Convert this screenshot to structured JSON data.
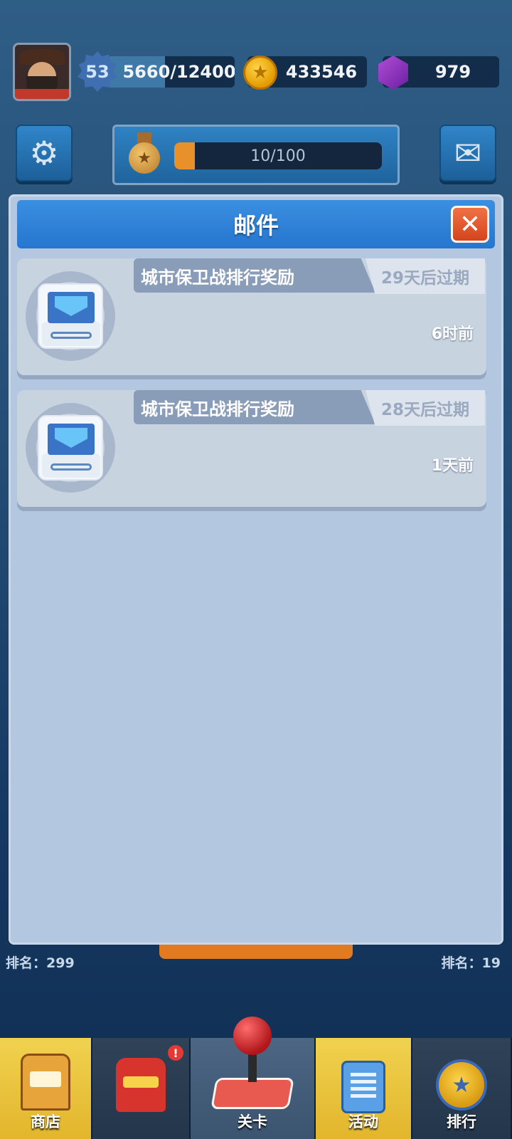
{
  "hud": {
    "level": "53",
    "xp_text": "5660/12400",
    "xp_fraction": 0.456,
    "coins": "433546",
    "gems": "979"
  },
  "progress": {
    "text": "10/100",
    "fraction": 0.1
  },
  "icons": {
    "settings": "gear-icon",
    "mail": "envelope-icon",
    "medal": "medal-icon",
    "coin": "coin-icon",
    "gem": "gem-icon"
  },
  "modal": {
    "title": "邮件",
    "close_label": "✕"
  },
  "mails": [
    {
      "subject": "城市保卫战排行奖励",
      "expires": "29天后过期",
      "time_ago": "6时前"
    },
    {
      "subject": "城市保卫战排行奖励",
      "expires": "28天后过期",
      "time_ago": "1天前"
    }
  ],
  "background": {
    "rank_left": "排名：299",
    "rank_right": "排名：19"
  },
  "nav": {
    "shop": "商店",
    "robot_alert": "!",
    "stage": "关卡",
    "activity": "活动",
    "rank": "排行"
  },
  "colors": {
    "accent_blue": "#2576cf",
    "close_red": "#d4451d",
    "progress_orange": "#e8912a",
    "modal_bg": "#b3c7e0"
  }
}
